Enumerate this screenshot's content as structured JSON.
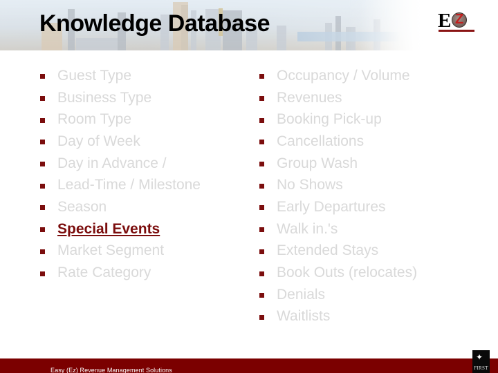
{
  "header": {
    "title": "Knowledge Database",
    "logo": {
      "letter_e": "E",
      "letter_z": "Z",
      "icon": "ez-logo-icon"
    }
  },
  "colors": {
    "bullet": "#7b0d0d",
    "text_dimmed": "#d9d9d9",
    "text_highlight": "#7b0d0d",
    "footer_bg": "#7b0000",
    "title": "#000000"
  },
  "left_column": {
    "items": [
      {
        "label": "Guest Type",
        "highlighted": false
      },
      {
        "label": "Business Type",
        "highlighted": false
      },
      {
        "label": "Room Type",
        "highlighted": false
      },
      {
        "label": "Day of Week",
        "highlighted": false
      },
      {
        "label": "Day in Advance /",
        "highlighted": false
      },
      {
        "label": "Lead-Time / Milestone",
        "highlighted": false
      },
      {
        "label": "Season",
        "highlighted": false
      },
      {
        "label": "Special Events",
        "highlighted": true
      },
      {
        "label": "Market Segment",
        "highlighted": false
      },
      {
        "label": "Rate Category",
        "highlighted": false
      }
    ]
  },
  "right_column": {
    "items": [
      {
        "label": "Occupancy / Volume",
        "highlighted": false
      },
      {
        "label": "Revenues",
        "highlighted": false
      },
      {
        "label": "Booking Pick-up",
        "highlighted": false
      },
      {
        "label": "Cancellations",
        "highlighted": false
      },
      {
        "label": "Group Wash",
        "highlighted": false
      },
      {
        "label": "No Shows",
        "highlighted": false
      },
      {
        "label": "Early Departures",
        "highlighted": false
      },
      {
        "label": "Walk in.'s",
        "highlighted": false
      },
      {
        "label": "Extended Stays",
        "highlighted": false
      },
      {
        "label": "Book Outs (relocates)",
        "highlighted": false
      },
      {
        "label": "Denials",
        "highlighted": false
      },
      {
        "label": "Waitlists",
        "highlighted": false
      }
    ]
  },
  "footer": {
    "text": "Easy (Ez) Revenue Management Solutions",
    "partner_logo_text": "FIRST",
    "partner_logo_icon": "eagle-icon"
  }
}
